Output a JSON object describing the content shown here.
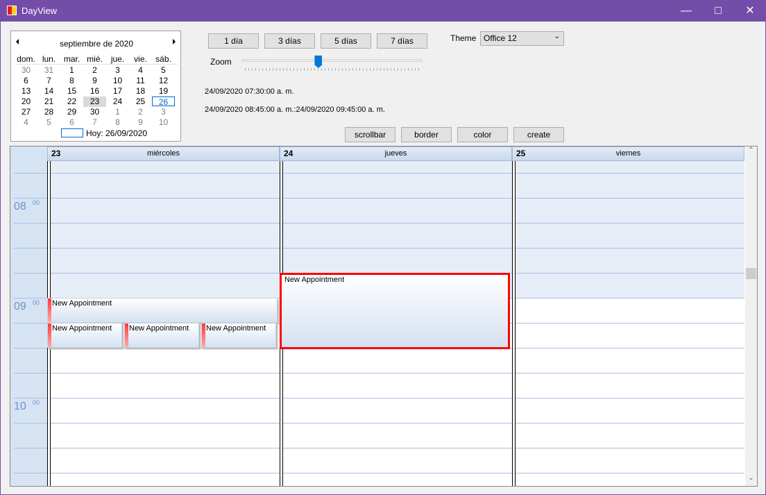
{
  "window": {
    "title": "DayView",
    "icon": "app-icon",
    "controls": [
      "minimize-icon",
      "maximize-icon",
      "close-icon"
    ]
  },
  "calendar": {
    "month_title": "septiembre de 2020",
    "weekdays": [
      "dom.",
      "lun.",
      "mar.",
      "mié.",
      "jue.",
      "vie.",
      "sáb."
    ],
    "weeks": [
      [
        "30",
        "31",
        "1",
        "2",
        "3",
        "4",
        "5"
      ],
      [
        "6",
        "7",
        "8",
        "9",
        "10",
        "11",
        "12"
      ],
      [
        "13",
        "14",
        "15",
        "16",
        "17",
        "18",
        "19"
      ],
      [
        "20",
        "21",
        "22",
        "23",
        "24",
        "25",
        "26"
      ],
      [
        "27",
        "28",
        "29",
        "30",
        "1",
        "2",
        "3"
      ],
      [
        "4",
        "5",
        "6",
        "7",
        "8",
        "9",
        "10"
      ]
    ],
    "selected": "23",
    "today_label": "Hoy: 26/09/2020"
  },
  "view_buttons": [
    "1 día",
    "3 días",
    "5 días",
    "7 días"
  ],
  "theme": {
    "label": "Theme",
    "value": "Office 12"
  },
  "zoom": {
    "label": "Zoom",
    "value_fraction": 0.41
  },
  "info": {
    "line1": "24/09/2020 07:30:00 a. m.",
    "line2": "24/09/2020 08:45:00 a. m.:24/09/2020 09:45:00 a. m."
  },
  "action_buttons": [
    "scrollbar",
    "border",
    "color",
    "create"
  ],
  "dayview": {
    "columns": [
      {
        "day": "23",
        "name": "miércoles"
      },
      {
        "day": "24",
        "name": "jueves"
      },
      {
        "day": "25",
        "name": "viernes"
      }
    ],
    "hours": [
      {
        "h": "08",
        "m": "00"
      },
      {
        "h": "09",
        "m": "00"
      },
      {
        "h": "10",
        "m": "00"
      }
    ],
    "appointments": [
      {
        "title": "New Appointment",
        "column": 0
      },
      {
        "title": "New Appointment",
        "column": 0
      },
      {
        "title": "New Appointment",
        "column": 0
      },
      {
        "title": "New Appointment",
        "column": 0
      },
      {
        "title": "New Appointment",
        "column": 1,
        "selected": true
      }
    ],
    "colors": {
      "nonwork": "#e6edf7",
      "work": "#ffffff",
      "ruler": "#d5e3f3",
      "selection_border": "#ff0000",
      "hour_text": "#6f94c8"
    }
  }
}
